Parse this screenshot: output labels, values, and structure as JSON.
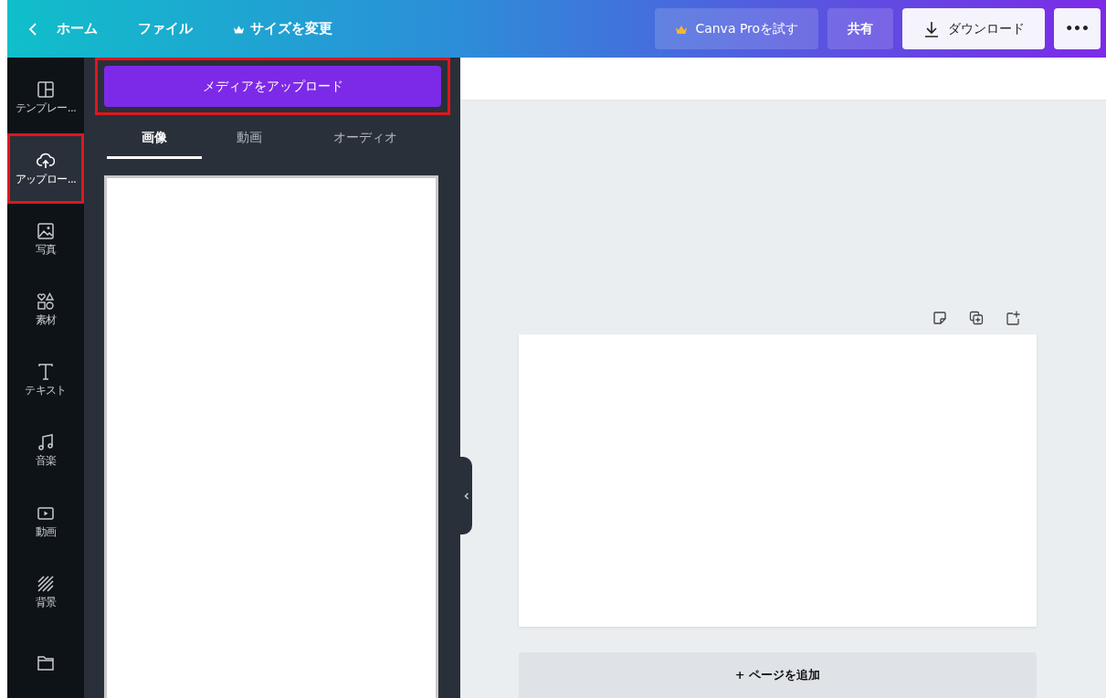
{
  "topbar": {
    "left": [
      {
        "kind": "back",
        "label": "ホーム"
      },
      {
        "kind": "plain",
        "label": "ファイル"
      },
      {
        "kind": "crown",
        "label": "サイズを変更"
      }
    ],
    "right": [
      {
        "kind": "pro",
        "label": "Canva Proを試す"
      },
      {
        "kind": "share",
        "label": "共有"
      },
      {
        "kind": "download",
        "label": "ダウンロード"
      },
      {
        "kind": "more",
        "label": "•••"
      }
    ]
  },
  "sidebar": {
    "items": [
      {
        "kind": "template",
        "label": "テンプレー...",
        "selected": false,
        "highlighted": false
      },
      {
        "kind": "upload",
        "label": "アップロー...",
        "selected": true,
        "highlighted": true
      },
      {
        "kind": "photo",
        "label": "写真",
        "selected": false,
        "highlighted": false
      },
      {
        "kind": "elements",
        "label": "素材",
        "selected": false,
        "highlighted": false
      },
      {
        "kind": "text",
        "label": "テキスト",
        "selected": false,
        "highlighted": false
      },
      {
        "kind": "music",
        "label": "音楽",
        "selected": false,
        "highlighted": false
      },
      {
        "kind": "video",
        "label": "動画",
        "selected": false,
        "highlighted": false
      },
      {
        "kind": "background",
        "label": "背景",
        "selected": false,
        "highlighted": false
      },
      {
        "kind": "folder",
        "selected": false,
        "highlighted": false
      }
    ]
  },
  "panel": {
    "upload_button": {
      "label": "メディアをアップロード",
      "highlighted": true
    },
    "tabs": [
      {
        "label": "画像",
        "selected": true
      },
      {
        "label": "動画",
        "selected": false
      },
      {
        "label": "オーディオ",
        "selected": false
      }
    ]
  },
  "canvas": {
    "add_page": "+ ページを追加"
  }
}
